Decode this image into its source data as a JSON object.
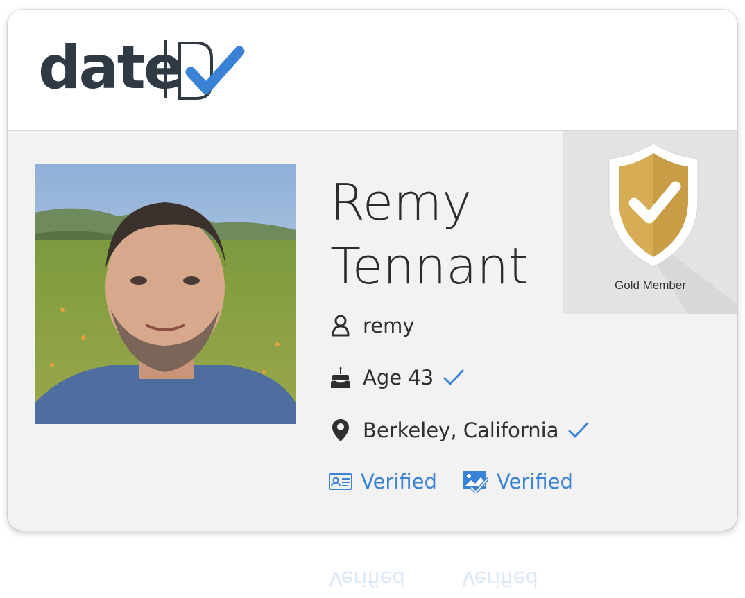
{
  "header": {
    "logo_text": "date"
  },
  "badge": {
    "label": "Gold Member"
  },
  "profile": {
    "first_name": "Remy",
    "last_name": "Tennant",
    "username": "remy",
    "age_label": "Age 43",
    "location": "Berkeley, California"
  },
  "verifications": [
    {
      "label": "Verified",
      "icon": "id-card-icon"
    },
    {
      "label": "Verified",
      "icon": "photo-check-icon"
    }
  ],
  "colors": {
    "accent": "#3a82d6",
    "gold": "#d6ad55",
    "logo": "#2f3a44"
  }
}
